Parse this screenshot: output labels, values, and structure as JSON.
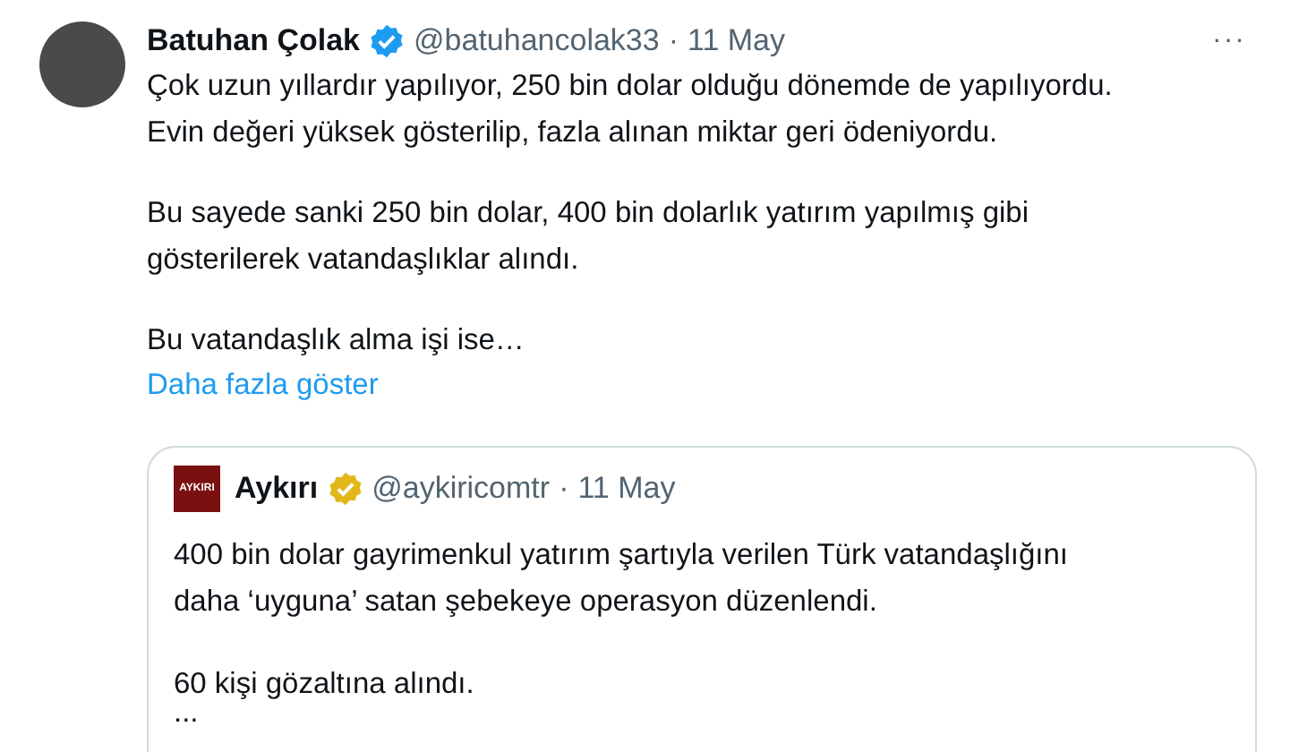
{
  "tweet": {
    "author": {
      "name": "Batuhan Çolak",
      "verified": true,
      "handle": "@batuhancolak33",
      "separator": "·",
      "date": "11 May"
    },
    "more_button": "···",
    "paragraphs": [
      {
        "lines": [
          "Çok uzun yıllardır yapılıyor, 250 bin dolar olduğu dönemde de yapılıyordu.",
          "Evin değeri yüksek gösterilip, fazla alınan miktar geri ödeniyordu."
        ]
      },
      {
        "lines": [
          "Bu sayede sanki 250 bin dolar, 400 bin dolarlık yatırım yapılmış gibi",
          "gösterilerek vatandaşlıklar alındı."
        ]
      },
      {
        "lines": [
          "Bu vatandaşlık alma işi ise…"
        ]
      }
    ],
    "show_more": "Daha fazla göster",
    "quote": {
      "author": {
        "logo_text": "AYKIRI",
        "name": "Aykırı",
        "verified": true,
        "handle": "@aykiricomtr",
        "separator": "·",
        "date": "11 May"
      },
      "paragraphs": [
        {
          "lines": [
            "400 bin dolar gayrimenkul yatırım şartıyla verilen Türk vatandaşlığını",
            "daha ‘uyguna’ satan şebekeye operasyon düzenlendi."
          ]
        },
        {
          "lines": [
            "60 kişi gözaltına alındı."
          ]
        },
        {
          "lines": [
            "..."
          ]
        }
      ]
    }
  }
}
